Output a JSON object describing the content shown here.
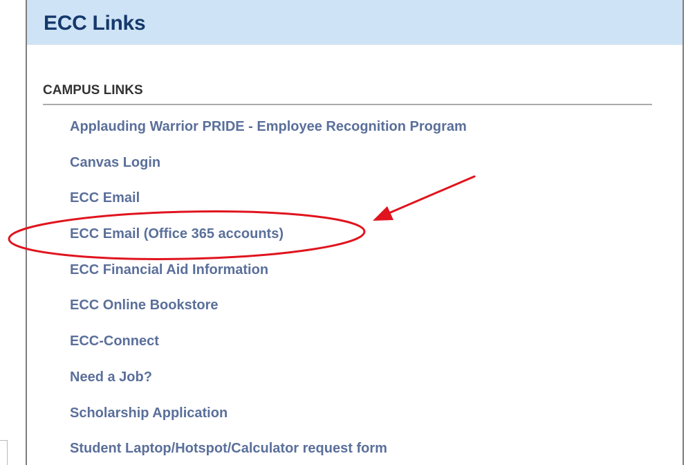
{
  "panel": {
    "title": "ECC Links"
  },
  "section": {
    "heading": "CAMPUS LINKS"
  },
  "links": [
    {
      "label": "Applauding Warrior PRIDE - Employee Recognition Program"
    },
    {
      "label": "Canvas Login"
    },
    {
      "label": "ECC Email"
    },
    {
      "label": "ECC Email (Office 365 accounts)",
      "highlighted": true
    },
    {
      "label": "ECC Financial Aid Information"
    },
    {
      "label": "ECC Online Bookstore"
    },
    {
      "label": "ECC-Connect"
    },
    {
      "label": "Need a Job?"
    },
    {
      "label": "Scholarship Application"
    },
    {
      "label": "Student Laptop/Hotspot/Calculator request form"
    }
  ],
  "colors": {
    "header_background": "#cfe3f6",
    "title_text": "#15396b",
    "link_text": "#5a6f9a",
    "heading_text": "#333333",
    "annotation": "#e0141e"
  },
  "annotation": {
    "type": "red-ellipse-and-arrow",
    "target_link_index": 3
  }
}
